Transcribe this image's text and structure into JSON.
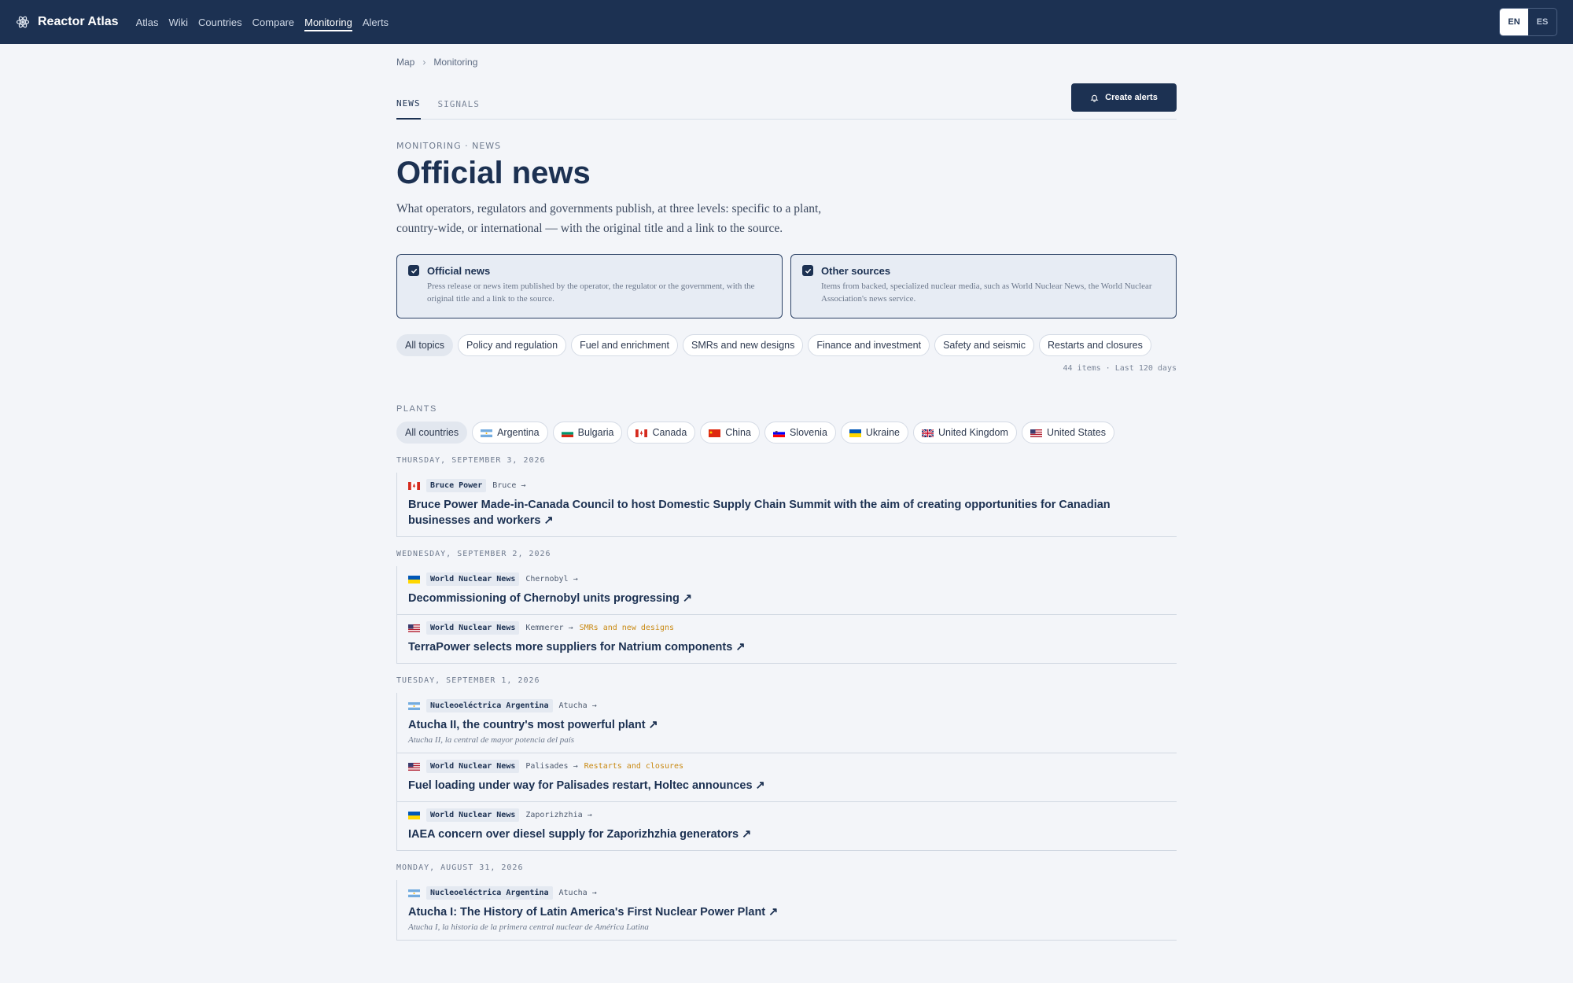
{
  "app": {
    "name": "Reactor Atlas"
  },
  "nav": {
    "items": [
      {
        "label": "Atlas"
      },
      {
        "label": "Wiki"
      },
      {
        "label": "Countries"
      },
      {
        "label": "Compare"
      },
      {
        "label": "Monitoring"
      },
      {
        "label": "Alerts"
      }
    ],
    "active": "Monitoring"
  },
  "language": {
    "options": [
      "EN",
      "ES"
    ],
    "selected": "EN"
  },
  "breadcrumb": {
    "items": [
      "Map",
      "Monitoring"
    ]
  },
  "tabs": {
    "items": [
      "NEWS",
      "SIGNALS"
    ],
    "active": "NEWS"
  },
  "create_alerts_label": "Create alerts",
  "header": {
    "kicker": "MONITORING · NEWS",
    "title": "Official news",
    "intro": "What operators, regulators and governments publish, at three levels: specific to a plant, country-wide, or international — with the original title and a link to the source."
  },
  "sources": [
    {
      "title": "Official news",
      "checked": true,
      "description": "Press release or news item published by the operator, the regulator or the government, with the original title and a link to the source."
    },
    {
      "title": "Other sources",
      "checked": true,
      "description": "Items from backed, specialized nuclear media, such as World Nuclear News, the World Nuclear Association's news service."
    }
  ],
  "topics": [
    "All topics",
    "Policy and regulation",
    "Fuel and enrichment",
    "SMRs and new designs",
    "Finance and investment",
    "Safety and seismic",
    "Restarts and closures"
  ],
  "topic_selected": "All topics",
  "count_text": "44 items · Last 120 days",
  "plants_label": "PLANTS",
  "countries": [
    {
      "label": "All countries",
      "flag": ""
    },
    {
      "label": "Argentina",
      "flag": "ar"
    },
    {
      "label": "Bulgaria",
      "flag": "bg"
    },
    {
      "label": "Canada",
      "flag": "ca"
    },
    {
      "label": "China",
      "flag": "cn"
    },
    {
      "label": "Slovenia",
      "flag": "si"
    },
    {
      "label": "Ukraine",
      "flag": "ua"
    },
    {
      "label": "United Kingdom",
      "flag": "gb"
    },
    {
      "label": "United States",
      "flag": "us"
    }
  ],
  "days": [
    {
      "date": "THURSDAY, SEPTEMBER 3, 2026",
      "items": [
        {
          "flag": "ca",
          "source": "Bruce Power",
          "plant": "Bruce →",
          "topic": "",
          "title": "Bruce Power Made-in-Canada Council to host Domestic Supply Chain Summit with the aim of creating opportunities for Canadian businesses and workers ↗",
          "original": ""
        }
      ]
    },
    {
      "date": "WEDNESDAY, SEPTEMBER 2, 2026",
      "items": [
        {
          "flag": "ua",
          "source": "World Nuclear News",
          "plant": "Chernobyl →",
          "topic": "",
          "title": "Decommissioning of Chernobyl units progressing ↗",
          "original": ""
        },
        {
          "flag": "us",
          "source": "World Nuclear News",
          "plant": "Kemmerer →",
          "topic": "SMRs and new designs",
          "title": "TerraPower selects more suppliers for Natrium components ↗",
          "original": ""
        }
      ]
    },
    {
      "date": "TUESDAY, SEPTEMBER 1, 2026",
      "items": [
        {
          "flag": "ar",
          "source": "Nucleoeléctrica Argentina",
          "plant": "Atucha →",
          "topic": "",
          "title": "Atucha II, the country's most powerful plant ↗",
          "original": "Atucha II, la central de mayor potencia del país"
        },
        {
          "flag": "us",
          "source": "World Nuclear News",
          "plant": "Palisades →",
          "topic": "Restarts and closures",
          "title": "Fuel loading under way for Palisades restart, Holtec announces ↗",
          "original": ""
        },
        {
          "flag": "ua",
          "source": "World Nuclear News",
          "plant": "Zaporizhzhia →",
          "topic": "",
          "title": "IAEA concern over diesel supply for Zaporizhzhia generators ↗",
          "original": ""
        }
      ]
    },
    {
      "date": "MONDAY, AUGUST 31, 2026",
      "items": [
        {
          "flag": "ar",
          "source": "Nucleoeléctrica Argentina",
          "plant": "Atucha →",
          "topic": "",
          "title": "Atucha I: The History of Latin America's First Nuclear Power Plant ↗",
          "original": "Atucha I, la historia de la primera central nuclear de América Latina"
        }
      ]
    }
  ],
  "colors": {
    "primary": "#1c3152",
    "background": "#f3f5f9",
    "topic_accent": "#c98a14"
  }
}
